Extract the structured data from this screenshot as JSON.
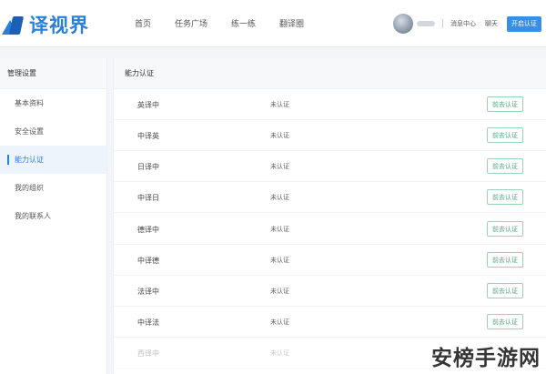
{
  "header": {
    "logo_text": "译视界",
    "nav": [
      "首页",
      "任务广场",
      "练一练",
      "翻译圈"
    ],
    "message_center": "消息中心",
    "chat": "聊天",
    "open_button": "开启认证"
  },
  "sidebar": {
    "title": "管理设置",
    "items": [
      {
        "label": "基本资料"
      },
      {
        "label": "安全设置"
      },
      {
        "label": "能力认证"
      },
      {
        "label": "我的组织"
      },
      {
        "label": "我的联系人"
      }
    ]
  },
  "main": {
    "title": "能力认证",
    "rows": [
      {
        "lang": "英译中",
        "status": "未认证",
        "action": "前去认证"
      },
      {
        "lang": "中译英",
        "status": "未认证",
        "action": "前去认证"
      },
      {
        "lang": "日译中",
        "status": "未认证",
        "action": "前去认证"
      },
      {
        "lang": "中译日",
        "status": "未认证",
        "action": "前去认证"
      },
      {
        "lang": "德译中",
        "status": "未认证",
        "action": "前去认证"
      },
      {
        "lang": "中译德",
        "status": "未认证",
        "action": "前去认证"
      },
      {
        "lang": "法译中",
        "status": "未认证",
        "action": "前去认证"
      },
      {
        "lang": "中译法",
        "status": "未认证",
        "action": "前去认证"
      },
      {
        "lang": "西译中",
        "status": "未认证",
        "action": ""
      }
    ]
  },
  "watermark": "安榜手游网",
  "colors": {
    "brand": "#2a7fd9",
    "button_green": "#4aa97e",
    "primary_button": "#3a8ee6"
  }
}
